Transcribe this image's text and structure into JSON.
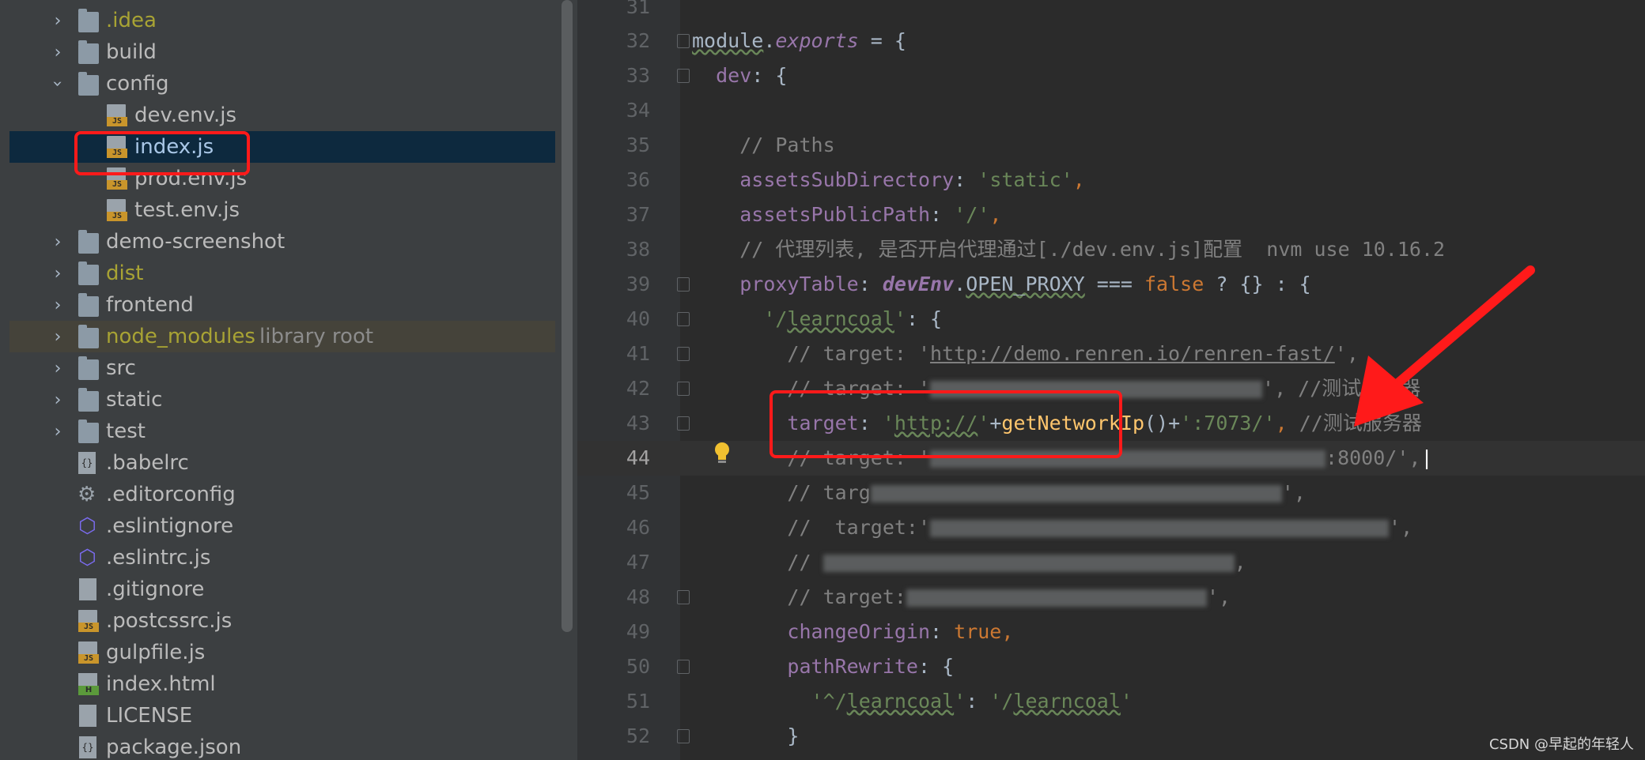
{
  "project_tree": {
    "items": [
      {
        "name": ".idea",
        "type": "folder",
        "expanded": false,
        "color": "yellow"
      },
      {
        "name": "build",
        "type": "folder",
        "expanded": false
      },
      {
        "name": "config",
        "type": "folder",
        "expanded": true
      },
      {
        "name": "dev.env.js",
        "type": "js-file"
      },
      {
        "name": "index.js",
        "type": "js-file",
        "selected": true
      },
      {
        "name": "prod.env.js",
        "type": "js-file"
      },
      {
        "name": "test.env.js",
        "type": "js-file"
      },
      {
        "name": "demo-screenshot",
        "type": "folder",
        "expanded": false
      },
      {
        "name": "dist",
        "type": "folder",
        "expanded": false,
        "color": "yellow"
      },
      {
        "name": "frontend",
        "type": "folder",
        "expanded": false
      },
      {
        "name": "node_modules",
        "type": "folder",
        "expanded": false,
        "color": "yellow",
        "suffix": "library root"
      },
      {
        "name": "src",
        "type": "folder",
        "expanded": false
      },
      {
        "name": "static",
        "type": "folder",
        "expanded": false
      },
      {
        "name": "test",
        "type": "folder",
        "expanded": false
      },
      {
        "name": ".babelrc",
        "type": "config-file"
      },
      {
        "name": ".editorconfig",
        "type": "gear-file"
      },
      {
        "name": ".eslintignore",
        "type": "eslint-file"
      },
      {
        "name": ".eslintrc.js",
        "type": "eslint-file"
      },
      {
        "name": ".gitignore",
        "type": "ignore-file"
      },
      {
        "name": ".postcssrc.js",
        "type": "js-file"
      },
      {
        "name": "gulpfile.js",
        "type": "js-file"
      },
      {
        "name": "index.html",
        "type": "html-file"
      },
      {
        "name": "LICENSE",
        "type": "text-file"
      },
      {
        "name": "package.json",
        "type": "json-file"
      }
    ]
  },
  "editor": {
    "lines": [
      {
        "n": "31",
        "text": ""
      },
      {
        "n": "32",
        "text": "module.exports = {"
      },
      {
        "n": "33",
        "text": "  dev: {"
      },
      {
        "n": "34",
        "text": ""
      },
      {
        "n": "35",
        "text": "    // Paths"
      },
      {
        "n": "36",
        "text": "    assetsSubDirectory: 'static',"
      },
      {
        "n": "37",
        "text": "    assetsPublicPath: '/',"
      },
      {
        "n": "38",
        "text": "    // 代理列表, 是否开启代理通过[./dev.env.js]配置  nvm use 10.16.2"
      },
      {
        "n": "39",
        "text": "    proxyTable: devEnv.OPEN_PROXY === false ? {} : {"
      },
      {
        "n": "40",
        "text": "      '/learncoal': {"
      },
      {
        "n": "41",
        "text": "        // target: 'http://demo.renren.io/renren-fast/',"
      },
      {
        "n": "42",
        "text": "        // target: 'http://192.168.1.101:7073/', //测试服务器"
      },
      {
        "n": "43",
        "text": "        target: 'http://'+getNetworkIp()+':7073/', //测试服务器"
      },
      {
        "n": "44",
        "text": "        // target: 'http://api.jinbang...:8000/',"
      },
      {
        "n": "45",
        "text": "        // target: 'http://api.jinbangshi...uang.com/',"
      },
      {
        "n": "46",
        "text": "        //  target:'http://api.jinbangshi...uang.com/',"
      },
      {
        "n": "47",
        "text": "        // target: 'http://...',"
      },
      {
        "n": "48",
        "text": "        // target: 'http://localhost:7073/',"
      },
      {
        "n": "49",
        "text": "        changeOrigin: true,"
      },
      {
        "n": "50",
        "text": "        pathRewrite: {"
      },
      {
        "n": "51",
        "text": "          '^/learncoal': '/learncoal'"
      },
      {
        "n": "52",
        "text": "        }"
      }
    ],
    "current_line": "44"
  },
  "watermark": "CSDN @早起的年轻人",
  "colors": {
    "annotation": "#ff1a1a",
    "selection": "#0d293e"
  }
}
